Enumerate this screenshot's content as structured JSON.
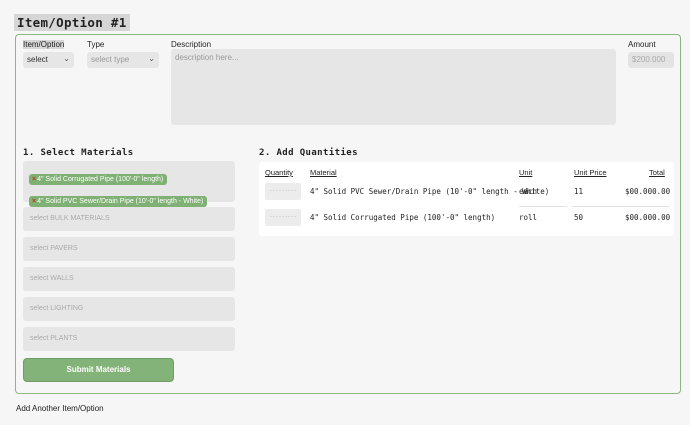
{
  "title": "Item/Option #1",
  "header": {
    "item_option_label": "Item/Option",
    "item_option_value": "select",
    "type_label": "Type",
    "type_placeholder": "select type",
    "description_label": "Description",
    "description_placeholder": "description here...",
    "amount_label": "Amount",
    "amount_placeholder": "$200.000"
  },
  "materials": {
    "section_title": "1. Select Materials",
    "selected_chips": [
      "4\" Solid Corrugated Pipe (100'-0\" length)",
      "4\" Solid PVC Sewer/Drain Pipe (10'-0\" length - White)"
    ],
    "selects": [
      "select BULK MATERIALS",
      "select PAVERS",
      "select WALLS",
      "select LIGHTING",
      "select PLANTS"
    ],
    "submit_label": "Submit Materials"
  },
  "quantities": {
    "section_title": "2. Add Quantities",
    "columns": [
      "Quantity",
      "Material",
      "Unit",
      "Unit Price",
      "Total"
    ],
    "rows": [
      {
        "qty": "---------",
        "material": "4\" Solid PVC Sewer/Drain Pipe (10'-0\" length - White)",
        "unit": "each",
        "unit_price": "11",
        "total": "$00.000.00"
      },
      {
        "qty": "---------",
        "material": "4\" Solid Corrugated Pipe (100'-0\" length)",
        "unit": "roll",
        "unit_price": "50",
        "total": "$00.000.00"
      }
    ]
  },
  "footer": {
    "add_another": "Add Another Item/Option"
  },
  "colors": {
    "accent": "#84b37a",
    "border": "#8ab87f",
    "remove": "#c2331c"
  }
}
